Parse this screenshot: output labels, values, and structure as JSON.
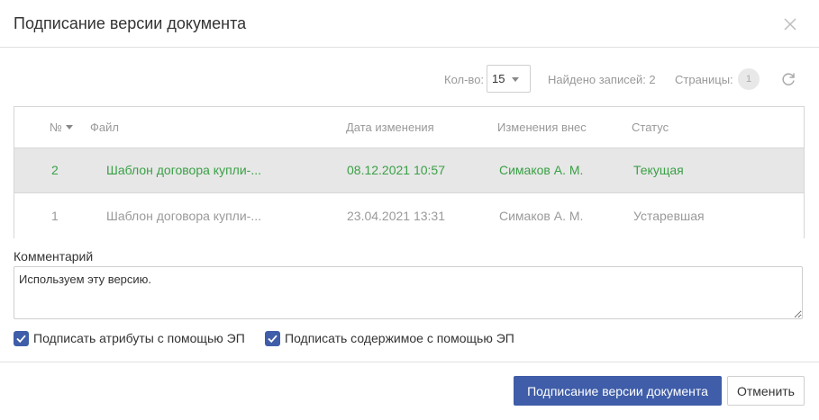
{
  "dialog": {
    "title": "Подписание версии документа"
  },
  "toolbar": {
    "count_label": "Кол-во:",
    "count_value": "15",
    "found_label": "Найдено записей: 2",
    "pages_label": "Страницы:",
    "current_page": "1"
  },
  "table": {
    "columns": {
      "number": "№",
      "file": "Файл",
      "date": "Дата изменения",
      "author": "Изменения внес",
      "status": "Статус"
    },
    "rows": [
      {
        "number": "2",
        "file": "Шаблон договора купли-...",
        "date": "08.12.2021 10:57",
        "author": "Симаков А. М.",
        "status": "Текущая"
      },
      {
        "number": "1",
        "file": "Шаблон договора купли-...",
        "date": "23.04.2021 13:31",
        "author": "Симаков А. М.",
        "status": "Устаревшая"
      }
    ]
  },
  "comment": {
    "label": "Комментарий",
    "value": "Используем эту версию."
  },
  "checkboxes": {
    "sign_attributes": {
      "label": "Подписать атрибуты с помощью ЭП",
      "checked": true
    },
    "sign_content": {
      "label": "Подписать содержимое с помощью ЭП",
      "checked": true
    }
  },
  "buttons": {
    "sign": "Подписание версии документа",
    "cancel": "Отменить"
  },
  "colors": {
    "primary": "#3f5da8",
    "current_row_text": "#3aa046",
    "selected_row_bg": "#e7e7e7",
    "muted_text": "#9a9a9a"
  }
}
